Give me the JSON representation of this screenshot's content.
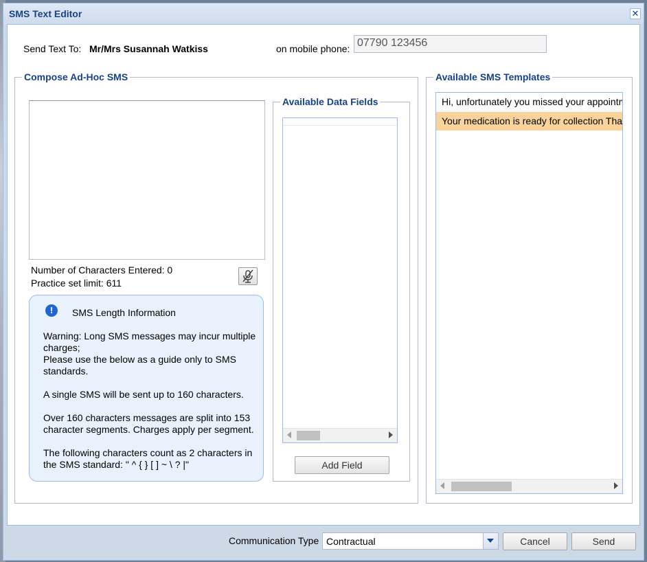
{
  "window": {
    "title": "SMS Text Editor"
  },
  "recipient": {
    "send_to_label": "Send Text To:",
    "name": "Mr/Mrs Susannah Watkiss",
    "phone_label": "on mobile phone:",
    "phone_value": "07790 123456"
  },
  "compose": {
    "legend": "Compose Ad-Hoc SMS",
    "chars_entered_label": "Number of Characters Entered: 0",
    "limit_label": "Practice set limit: 611",
    "info": {
      "heading": "SMS Length Information",
      "p1": "Warning: Long SMS messages may incur multiple\ncharges;\nPlease use the below as a guide only to SMS\nstandards.",
      "p2": "A single SMS will be sent up to 160 characters.",
      "p3": "Over 160 characters messages are split into 153\ncharacter segments. Charges apply per segment.",
      "p4": "The following characters count as 2 characters in\nthe SMS standard: \" ^ { } [ ] ~ \\ ? |\""
    }
  },
  "data_fields": {
    "legend": "Available Data Fields",
    "add_field_label": "Add Field"
  },
  "templates": {
    "legend": "Available SMS Templates",
    "items": [
      {
        "text": "Hi, unfortunately you missed your appointm"
      },
      {
        "text": "Your medication is ready for collection Thar"
      }
    ],
    "selected_color": "#fad39a"
  },
  "footer": {
    "comm_type_label": "Communication Type",
    "comm_type_value": "Contractual",
    "cancel_label": "Cancel",
    "send_label": "Send"
  },
  "colors": {
    "title": "#15428b",
    "border": "#99bbe8"
  }
}
